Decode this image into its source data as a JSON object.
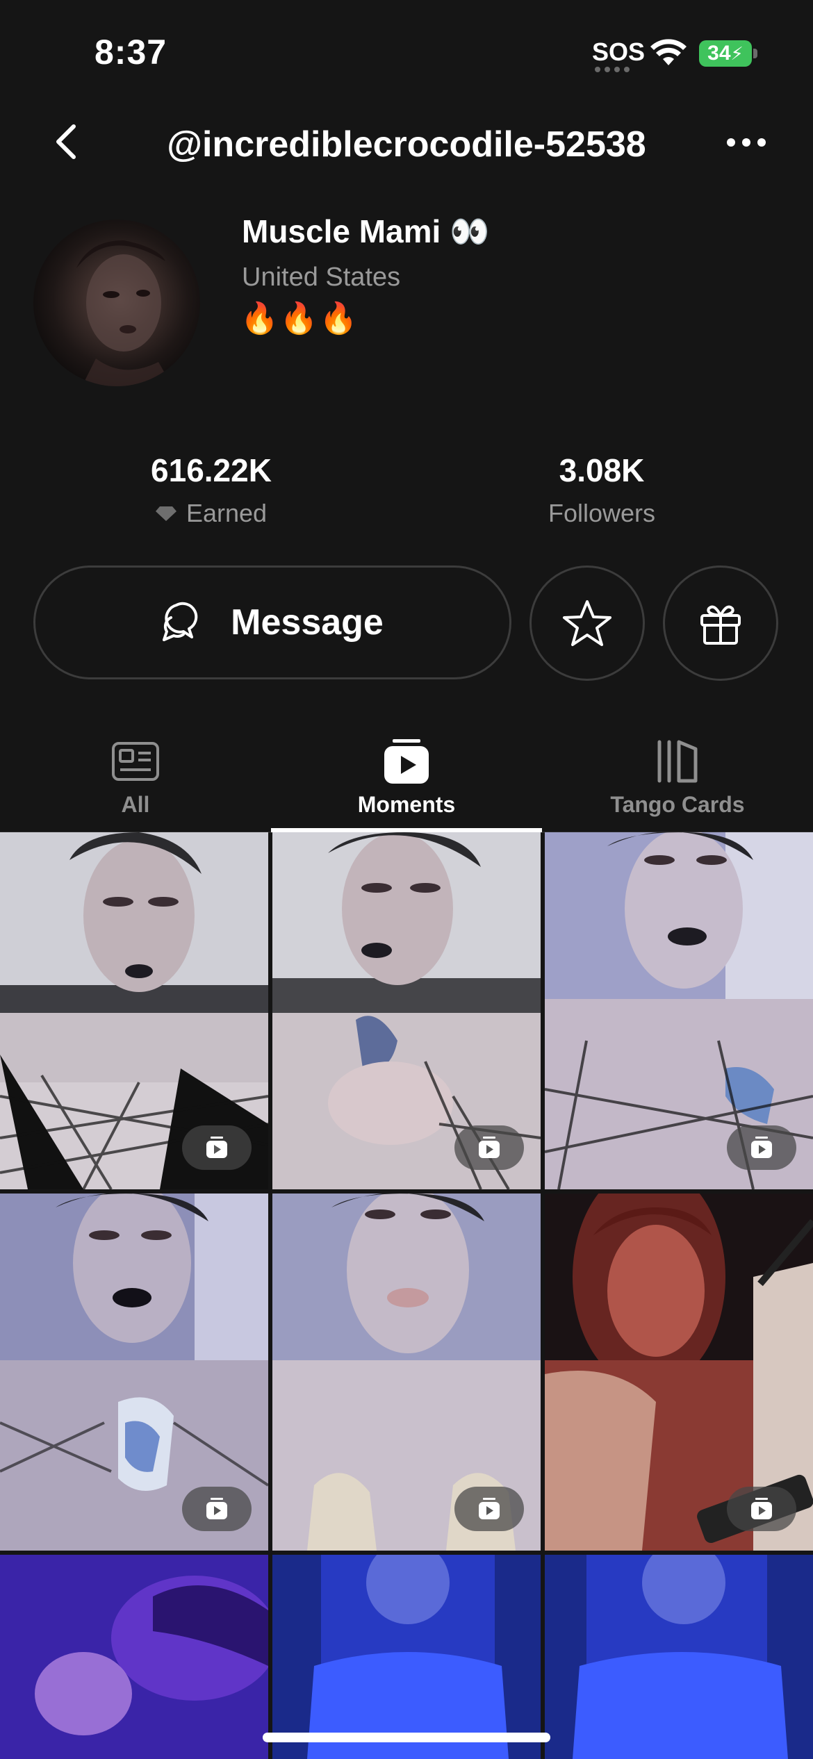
{
  "status_bar": {
    "time": "8:37",
    "sos": "SOS",
    "battery": "34"
  },
  "header": {
    "handle": "@incrediblecrocodile-52538",
    "back_icon": "chevron-left-icon",
    "more_icon": "ellipsis-icon"
  },
  "profile": {
    "display_name": "Muscle Mami 👀",
    "location": "United States",
    "bio": "🔥🔥🔥"
  },
  "stats": {
    "earned_value": "616.22K",
    "earned_label": "Earned",
    "followers_value": "3.08K",
    "followers_label": "Followers"
  },
  "actions": {
    "message_label": "Message",
    "favorite_icon": "star-icon",
    "gift_icon": "gift-icon"
  },
  "tabs": [
    {
      "label": "All",
      "icon": "profile-card-icon",
      "active": false
    },
    {
      "label": "Moments",
      "icon": "play-box-icon",
      "active": true
    },
    {
      "label": "Tango Cards",
      "icon": "cards-icon",
      "active": false
    }
  ],
  "colors": {
    "background": "#151515",
    "text_primary": "#ffffff",
    "text_secondary": "#9a9a9a",
    "border": "#3c3c3c",
    "battery": "#3fc35c"
  },
  "grid": {
    "tile_count": 9,
    "badge_icon": "moment-video-icon"
  }
}
